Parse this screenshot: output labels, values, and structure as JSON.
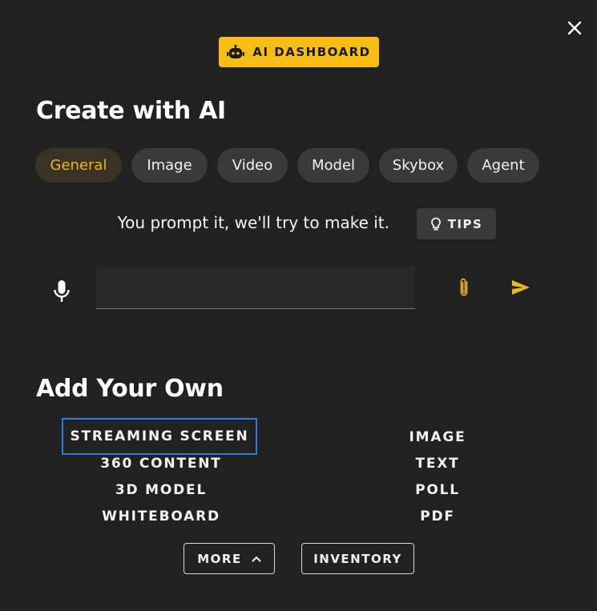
{
  "header": {
    "close_icon": "close-icon",
    "dashboard_label": "AI DASHBOARD",
    "dashboard_icon": "robot-icon",
    "accent_color": "#f6bd16"
  },
  "create": {
    "title": "Create with AI",
    "tabs": [
      {
        "label": "General",
        "active": true
      },
      {
        "label": "Image",
        "active": false
      },
      {
        "label": "Video",
        "active": false
      },
      {
        "label": "Model",
        "active": false
      },
      {
        "label": "Skybox",
        "active": false
      },
      {
        "label": "Agent",
        "active": false
      }
    ],
    "subtitle": "You prompt it, we'll try to make it.",
    "tips_label": "TIPS",
    "tips_icon": "lightbulb-icon",
    "prompt_value": "",
    "mic_icon": "microphone-icon",
    "attach_icon": "paperclip-icon",
    "send_icon": "send-icon"
  },
  "add": {
    "title": "Add Your Own",
    "left_items": [
      "STREAMING SCREEN",
      "360 CONTENT",
      "3D MODEL",
      "WHITEBOARD"
    ],
    "right_items": [
      "IMAGE",
      "TEXT",
      "POLL",
      "PDF"
    ],
    "selected_item": "STREAMING SCREEN",
    "more_label": "MORE",
    "more_icon": "chevron-up-icon",
    "inventory_label": "INVENTORY"
  }
}
